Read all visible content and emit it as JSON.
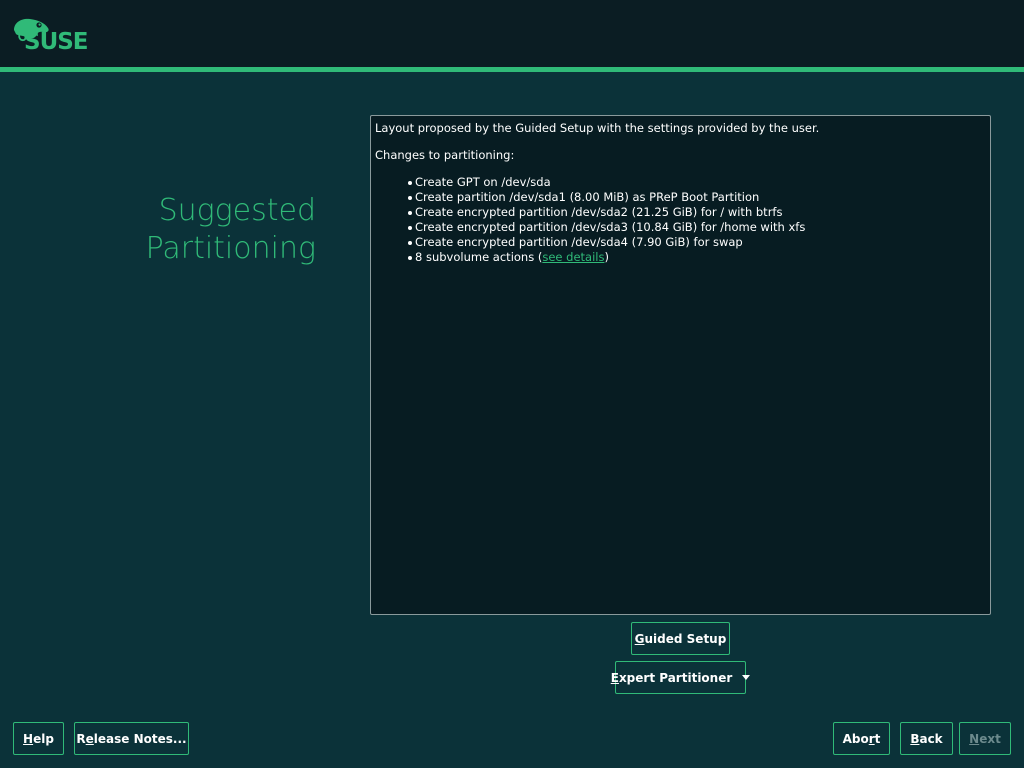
{
  "header": {
    "logo_text": "SUSE",
    "accent_color": "#30ba78",
    "background": "#0b1d23"
  },
  "page": {
    "title_line1": "Suggested",
    "title_line2": "Partitioning"
  },
  "proposal": {
    "intro": "Layout proposed by the Guided Setup with the settings provided by the user.",
    "changes_heading": "Changes to partitioning:",
    "items": [
      "Create GPT on /dev/sda",
      "Create partition /dev/sda1 (8.00 MiB) as PReP Boot Partition",
      "Create encrypted partition /dev/sda2 (21.25 GiB) for / with btrfs",
      "Create encrypted partition /dev/sda3 (10.84 GiB) for /home with xfs",
      "Create encrypted partition /dev/sda4 (7.90 GiB) for swap"
    ],
    "subvolume_prefix": "8 subvolume actions (",
    "subvolume_link": "see details",
    "subvolume_suffix": ")"
  },
  "actions": {
    "guided_setup": {
      "mnemonic": "G",
      "rest": "uided Setup"
    },
    "expert_partitioner": {
      "mnemonic": "E",
      "rest": "xpert Partitioner"
    }
  },
  "footer": {
    "help": {
      "mnemonic": "H",
      "rest": "elp"
    },
    "release_notes": {
      "pre": "R",
      "mnemonic": "e",
      "rest": "lease Notes..."
    },
    "abort": {
      "pre": "Abo",
      "mnemonic": "r",
      "rest": "t"
    },
    "back": {
      "mnemonic": "B",
      "rest": "ack"
    },
    "next": {
      "mnemonic": "N",
      "rest": "ext"
    }
  }
}
